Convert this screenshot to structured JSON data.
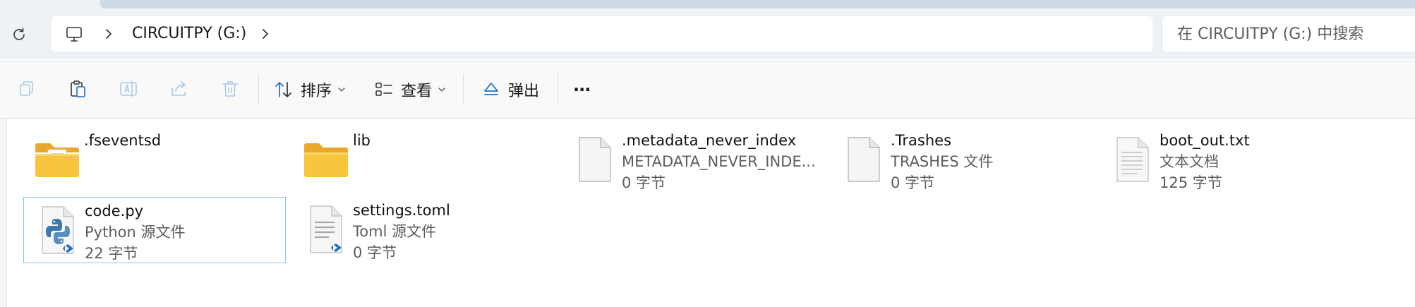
{
  "address_bar": {
    "location": "CIRCUITPY (G:)"
  },
  "search": {
    "placeholder": "在 CIRCUITPY (G:) 中搜索"
  },
  "toolbar": {
    "sort_label": "排序",
    "view_label": "查看",
    "eject_label": "弹出",
    "more_label": "···"
  },
  "files": [
    {
      "name": ".fseventsd",
      "type": "",
      "size": "",
      "icon": "folder-with-files-icon"
    },
    {
      "name": "lib",
      "type": "",
      "size": "",
      "icon": "folder-icon"
    },
    {
      "name": ".metadata_never_index",
      "type": "METADATA_NEVER_INDE...",
      "size": "0 字节",
      "icon": "blank-file-icon"
    },
    {
      "name": ".Trashes",
      "type": "TRASHES 文件",
      "size": "0 字节",
      "icon": "blank-file-icon"
    },
    {
      "name": "boot_out.txt",
      "type": "文本文档",
      "size": "125 字节",
      "icon": "text-document-icon"
    },
    {
      "name": "code.py",
      "type": "Python 源文件",
      "size": "22 字节",
      "icon": "python-file-icon"
    },
    {
      "name": "settings.toml",
      "type": "Toml 源文件",
      "size": "0 字节",
      "icon": "toml-file-icon"
    }
  ],
  "colors": {
    "chrome_background": "#eef2f6",
    "toolbar_background": "#f9f9f9",
    "selection_border": "#8fc1ea",
    "accent_blue": "#1f6fc5",
    "folder_yellow": "#f8c63d"
  }
}
